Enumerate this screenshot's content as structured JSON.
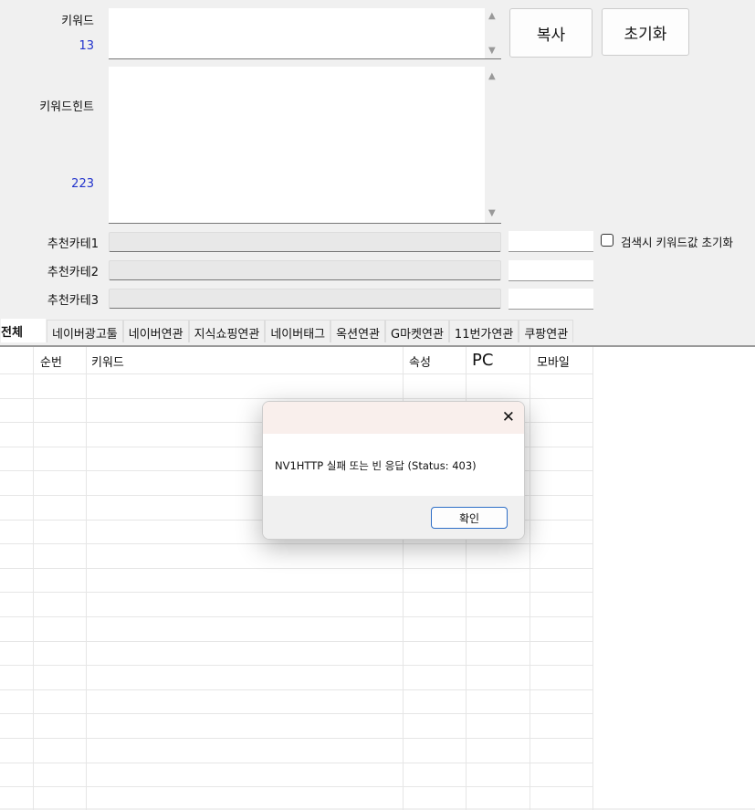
{
  "form": {
    "keyword_label": "키워드",
    "keyword_count": "13",
    "hint_label": "키워드힌트",
    "hint_count": "223",
    "copy_button": "복사",
    "reset_button": "초기화",
    "categories": [
      "추천카테1",
      "추천카테2",
      "추천카테3"
    ],
    "reset_on_search_label": "검색시 키워드값 초기화"
  },
  "tabs": [
    "전체",
    "네이버광고툴",
    "네이버연관",
    "지식쇼핑연관",
    "네이버태그",
    "옥션연관",
    "G마켓연관",
    "11번가연관",
    "쿠팡연관"
  ],
  "table": {
    "headers": [
      "",
      "순번",
      "키워드",
      "속성",
      "PC",
      "모바일"
    ]
  },
  "dialog": {
    "message": "NV1HTTP 실패 또는 빈 응답 (Status: 403)",
    "ok_button": "확인",
    "close": "✕"
  }
}
